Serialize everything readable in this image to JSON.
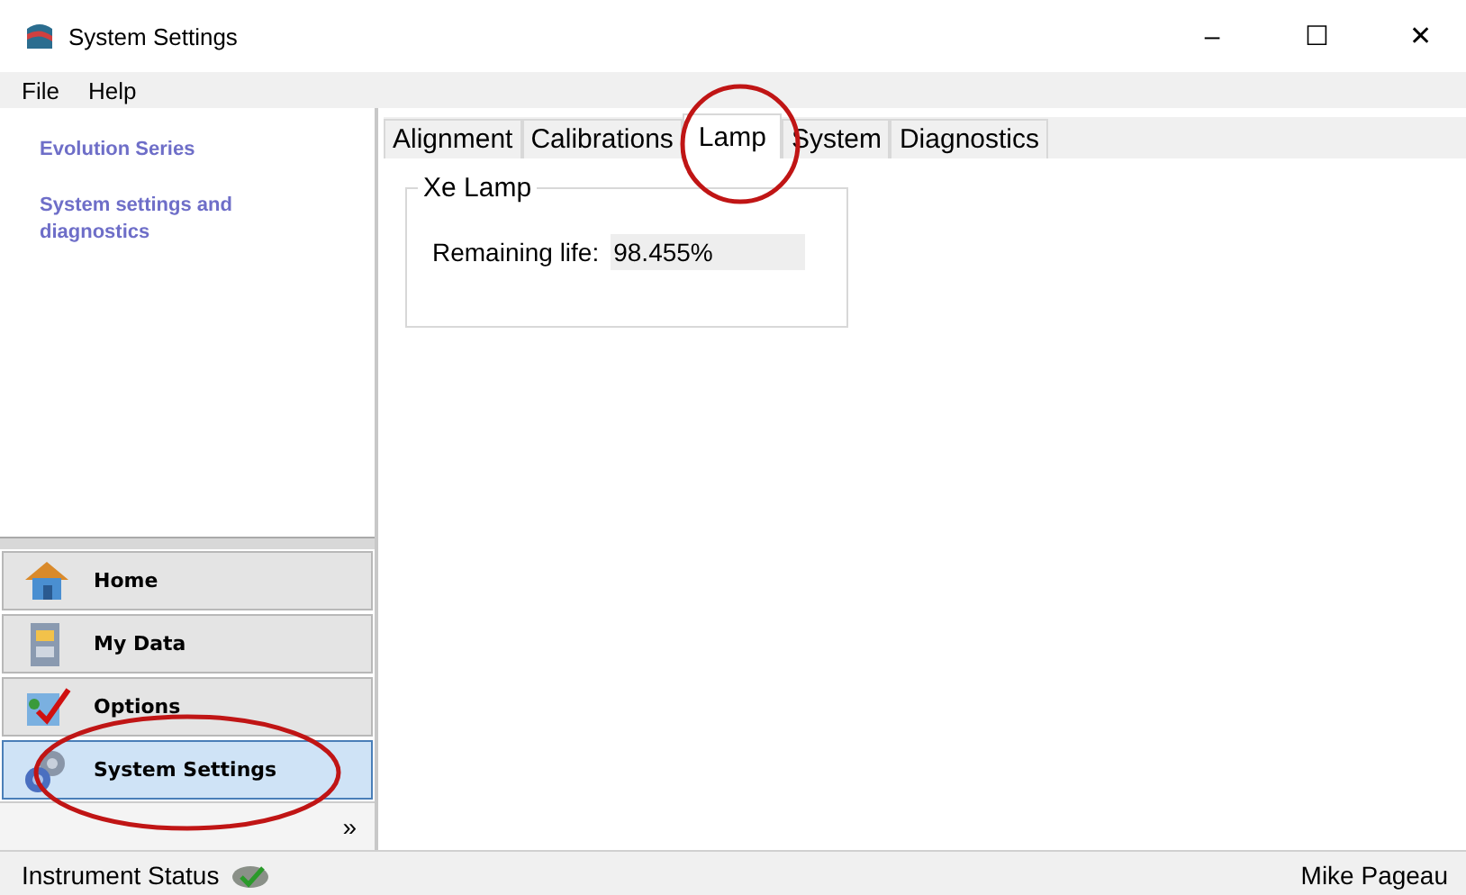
{
  "window": {
    "title": "System Settings",
    "controls": [
      "–",
      "☐",
      "✕"
    ]
  },
  "menu": [
    "File",
    "Help"
  ],
  "sidebar": {
    "links": [
      "Evolution Series",
      "System settings and diagnostics"
    ],
    "nav": [
      {
        "label": "Home",
        "kind": "home",
        "selected": false
      },
      {
        "label": "My Data",
        "kind": "data",
        "selected": false
      },
      {
        "label": "Options",
        "kind": "options",
        "selected": false
      },
      {
        "label": "System Settings",
        "kind": "settings",
        "selected": true
      }
    ],
    "more": "»"
  },
  "tabs": [
    {
      "label": "Alignment",
      "selected": false
    },
    {
      "label": "Calibrations",
      "selected": false
    },
    {
      "label": "Lamp",
      "selected": true
    },
    {
      "label": "System",
      "selected": false
    },
    {
      "label": "Diagnostics",
      "selected": false
    }
  ],
  "group": {
    "title": "Xe Lamp",
    "label": "Remaining life:",
    "value": "98.455%"
  },
  "status_bar": {
    "left": "Instrument Status",
    "right": "Mike Pageau"
  }
}
